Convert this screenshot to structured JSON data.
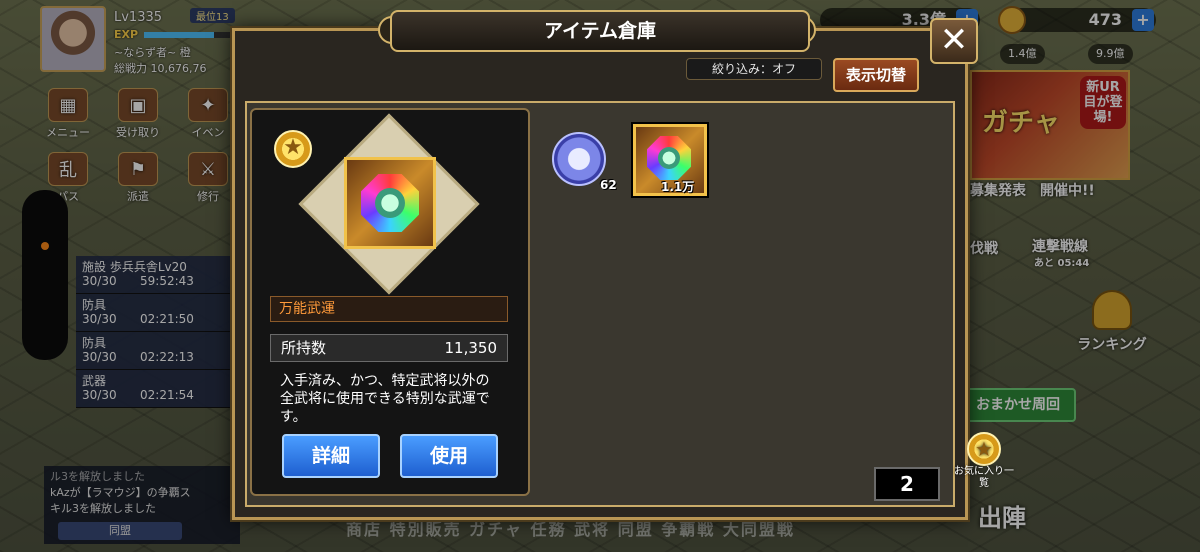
{
  "player": {
    "level": "Lv1335",
    "rank_badge": "最位13",
    "exp_label": "EXP",
    "exp_progress": 0.78,
    "name": "~ならず者~ 橙",
    "power": "総戦力 10,676,76"
  },
  "left_menu": {
    "items": [
      {
        "label": "メニュー",
        "icon": "grid-icon"
      },
      {
        "label": "受け取り",
        "icon": "chest-icon"
      },
      {
        "label": "イベン",
        "icon": "event-icon"
      },
      {
        "label": "パス",
        "icon": "pass-icon"
      },
      {
        "label": "派遣",
        "icon": "dispatch-icon"
      },
      {
        "label": "修行",
        "icon": "training-icon"
      }
    ]
  },
  "queue": [
    {
      "title": "施設 歩兵兵舎Lv20",
      "count": "30/30",
      "time": "59:52:43"
    },
    {
      "title": "防具",
      "count": "30/30",
      "time": "02:21:50"
    },
    {
      "title": "防具",
      "count": "30/30",
      "time": "02:22:13"
    },
    {
      "title": "武器",
      "count": "30/30",
      "time": "02:21:54"
    }
  ],
  "chat": {
    "line1": "ル3を解放しました",
    "line2": "kAzが【ラマウジ】の争覇ス",
    "line3": "キル3を解放しました",
    "alliance_btn": "同盟"
  },
  "resources": {
    "gold": "473",
    "stamina_top": "3.3億",
    "sub1": "1.4億",
    "sub2": "9.9億"
  },
  "right_side": {
    "gacha_label": "ガチャ",
    "new_ur": "新UR目が登場!",
    "event1": "募集発表",
    "event2": "開催中!!",
    "event3": "伐戦",
    "event4": "連撃戦線",
    "event4_sub": "あと 05:44",
    "ranking": "ランキング",
    "auto_loop": "おまかせ周回",
    "favorites": "お気に入り一覧",
    "deploy": "出陣"
  },
  "bottom_nav": "商店 特別販売 ガチャ 任務 武将 同盟 争覇戦 大同盟戦",
  "modal": {
    "title": "アイテム倉庫",
    "filter": "絞り込み：オフ",
    "toggle_view": "表示切替",
    "detail": {
      "name": "万能武運",
      "count_label": "所持数",
      "count_value": "11,350",
      "description": "入手済み、かつ、特定武将以外の全武将に使用できる特別な武運です。",
      "details_btn": "詳細",
      "use_btn": "使用"
    },
    "items": [
      {
        "icon": "blue-coin-icon",
        "qty": "62"
      },
      {
        "icon": "rainbow-gem-icon",
        "qty": "1.1万",
        "selected": true
      }
    ],
    "page": "2"
  }
}
